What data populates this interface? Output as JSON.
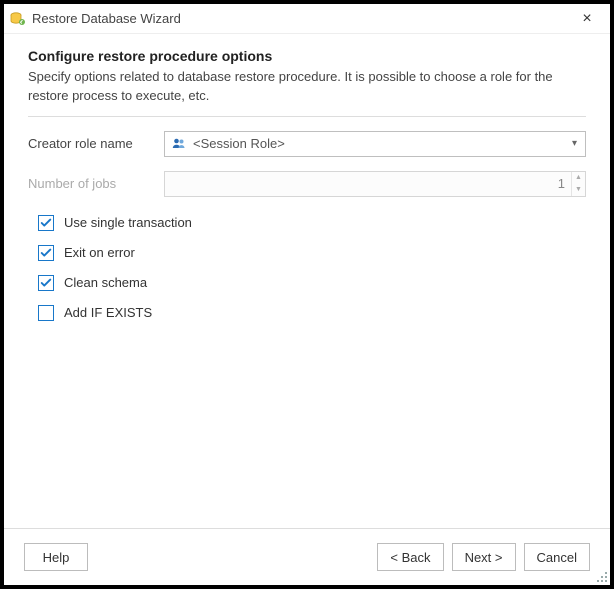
{
  "window": {
    "title": "Restore Database Wizard"
  },
  "header": {
    "title": "Configure restore procedure options",
    "subtitle": "Specify options related to database restore procedure. It is possible to choose a role for the restore process to execute, etc."
  },
  "form": {
    "creator_role_label": "Creator role name",
    "creator_role_value": "<Session Role>",
    "jobs_label": "Number of jobs",
    "jobs_value": "1"
  },
  "options": {
    "single_transaction": {
      "label": "Use single transaction",
      "checked": true
    },
    "exit_on_error": {
      "label": "Exit on error",
      "checked": true
    },
    "clean_schema": {
      "label": "Clean schema",
      "checked": true
    },
    "add_if_exists": {
      "label": "Add IF EXISTS",
      "checked": false
    }
  },
  "buttons": {
    "help": "Help",
    "back": "< Back",
    "next": "Next >",
    "cancel": "Cancel"
  }
}
